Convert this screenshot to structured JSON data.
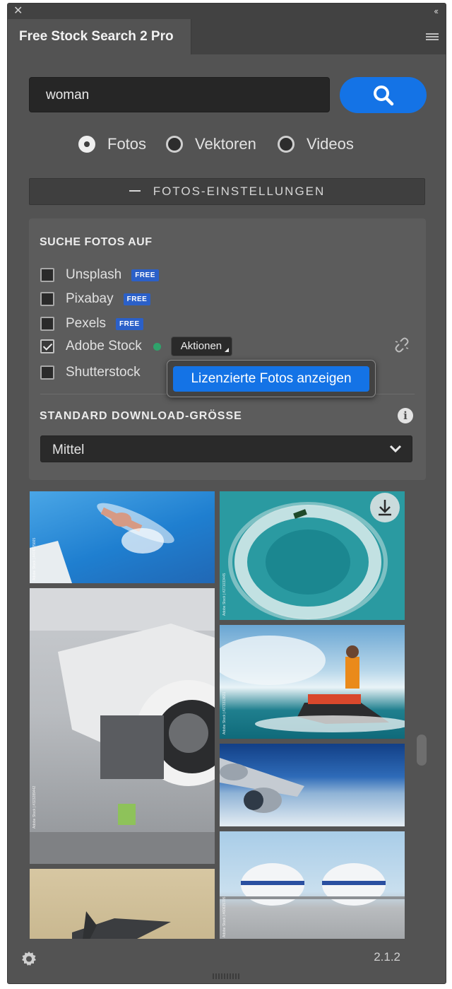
{
  "window": {
    "title": "Free Stock Search 2 Pro",
    "close_icon": "close-icon",
    "collapse_icon": "double-chevron-left-icon",
    "menu_icon": "hamburger-menu-icon"
  },
  "search": {
    "value": "woman",
    "button_icon": "search-icon",
    "button_color": "#1473e6"
  },
  "media_types": [
    {
      "label": "Fotos",
      "selected": true
    },
    {
      "label": "Vektoren",
      "selected": false
    },
    {
      "label": "Videos",
      "selected": false
    }
  ],
  "settings": {
    "header": "FOTOS-EINSTELLUNGEN",
    "sources_title": "SUCHE FOTOS AUF",
    "sources": [
      {
        "label": "Unsplash",
        "checked": false,
        "badge": "FREE"
      },
      {
        "label": "Pixabay",
        "checked": false,
        "badge": "FREE"
      },
      {
        "label": "Pexels",
        "checked": false,
        "badge": "FREE"
      },
      {
        "label": "Adobe Stock",
        "checked": true,
        "status_color": "#2fa36b",
        "actions_label": "Aktionen"
      },
      {
        "label": "Shutterstock",
        "checked": false
      }
    ],
    "download_title": "STANDARD DOWNLOAD-GRÖSSE",
    "download_value": "Mittel",
    "info_icon": "info-icon"
  },
  "popup": {
    "item_label": "Lizenzierte Fotos anzeigen"
  },
  "results": [
    {
      "name": "swimming-woman-photo",
      "watermark": "Adobe Stock | #474725665"
    },
    {
      "name": "aircraft-engine-photo",
      "watermark": "Adobe Stock | #323289442"
    },
    {
      "name": "fighter-jet-photo",
      "watermark": ""
    },
    {
      "name": "jetski-aerial-photo",
      "watermark": "Adobe Stock | #271033445"
    },
    {
      "name": "jetski-rider-photo",
      "watermark": "Adobe Stock | #273313821"
    },
    {
      "name": "airplane-wing-photo",
      "watermark": ""
    },
    {
      "name": "jumbo-jets-photo",
      "watermark": "Adobe Stock | #60635705"
    }
  ],
  "footer": {
    "settings_icon": "gear-icon",
    "version": "2.1.2"
  }
}
